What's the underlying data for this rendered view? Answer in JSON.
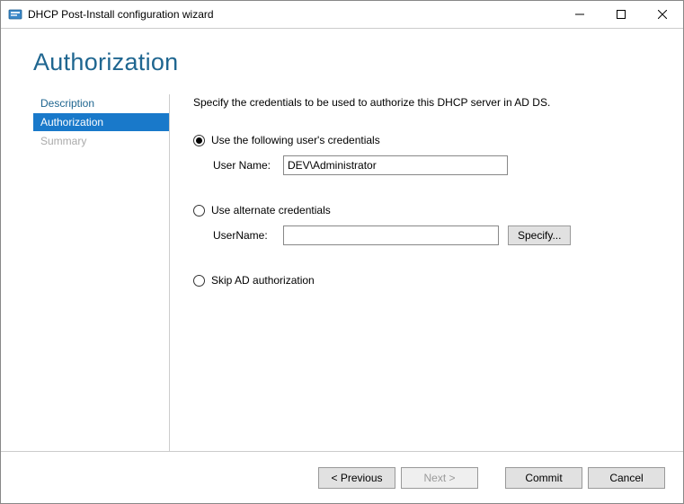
{
  "window": {
    "title": "DHCP Post-Install configuration wizard"
  },
  "header": {
    "title": "Authorization"
  },
  "sidebar": {
    "items": [
      {
        "label": "Description",
        "state": "normal"
      },
      {
        "label": "Authorization",
        "state": "active"
      },
      {
        "label": "Summary",
        "state": "disabled"
      }
    ]
  },
  "main": {
    "instruction": "Specify the credentials to be used to authorize this DHCP server in AD DS.",
    "option1": {
      "label": "Use the following user's credentials",
      "field_label": "User Name:",
      "field_value": "DEV\\Administrator"
    },
    "option2": {
      "label": "Use alternate credentials",
      "field_label": "UserName:",
      "field_value": "",
      "specify_label": "Specify..."
    },
    "option3": {
      "label": "Skip AD authorization"
    }
  },
  "footer": {
    "previous": "< Previous",
    "next": "Next >",
    "commit": "Commit",
    "cancel": "Cancel"
  }
}
